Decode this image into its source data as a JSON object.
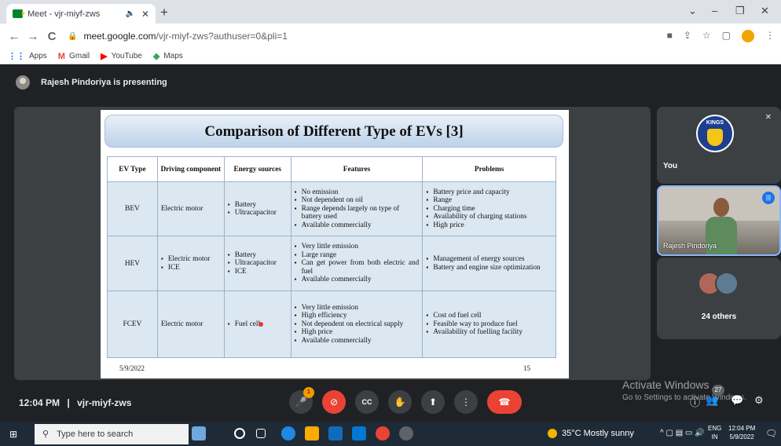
{
  "browser": {
    "tab_title": "Meet - vjr-miyf-zws",
    "tab_audio_icon": "speaker-icon",
    "tab_close": "✕",
    "new_tab": "+",
    "window_controls": [
      "⌄",
      "–",
      "❐",
      "✕"
    ],
    "nav": {
      "back": "←",
      "forward": "→",
      "reload": "C"
    },
    "url_host": "meet.google.com",
    "url_path": "/vjr-miyf-zws?authuser=0&pli=1",
    "bookmarks": [
      {
        "label": "Apps",
        "icon": "⋮⋮",
        "color": "#1a73e8"
      },
      {
        "label": "Gmail",
        "icon": "M",
        "color": "#ea4335"
      },
      {
        "label": "YouTube",
        "icon": "▶",
        "color": "#ff0000"
      },
      {
        "label": "Maps",
        "icon": "◆",
        "color": "#34a853"
      }
    ]
  },
  "meet": {
    "presenter_text": "Rajesh Pindoriya is presenting",
    "meeting_time": "12:04 PM",
    "meeting_separator": "|",
    "meeting_code": "vjr-miyf-zws",
    "raise_badge": "1",
    "people_badge": "27"
  },
  "slide": {
    "title": "Comparison of Different Type of EVs [3]",
    "headers": [
      "EV Type",
      "Driving component",
      "Energy sources",
      "Features",
      "Problems"
    ],
    "rows": [
      {
        "type": "BEV",
        "driving": "Electric motor",
        "energy": [
          "Battery",
          "Ultracapacitor"
        ],
        "features": [
          "No emission",
          "Not dependent on oil",
          "Range depends largely on type of battery used",
          "Available commercially"
        ],
        "problems": [
          "Battery price and capacity",
          "Range",
          "Charging time",
          "Availability of charging stations",
          "High price"
        ]
      },
      {
        "type": "HEV",
        "driving_list": [
          "Electric motor",
          "ICE"
        ],
        "energy": [
          "Battery",
          "Ultracapacitor",
          "ICE"
        ],
        "features": [
          "Very little emission",
          "Large range",
          "Can get power from both electric and fuel",
          "Available commercially"
        ],
        "problems": [
          "Management of energy sources",
          "Battery and engine size optimization"
        ]
      },
      {
        "type": "FCEV",
        "driving": "Electric motor",
        "energy": [
          "Fuel cell"
        ],
        "features": [
          "Very little emission",
          "High efficiency",
          "Not dependent on electrical supply",
          "High price",
          "Available commercially"
        ],
        "problems": [
          "Cost od fuel cell",
          "Feasible way to produce fuel",
          "Availability of fuelling facility"
        ]
      }
    ],
    "date": "5/9/2022",
    "page": "15"
  },
  "participants": {
    "you_label": "You",
    "logo_text": "KINGS",
    "cam_name": "Rajesh Pindoriya",
    "others_label": "24 others"
  },
  "watermark": {
    "line1": "Activate Windows",
    "line2": "Go to Settings to activate Windows."
  },
  "taskbar": {
    "search_placeholder": "Type here to search",
    "weather": "35°C  Mostly sunny",
    "lang1": "ENG",
    "lang2": "IN",
    "time": "12:04 PM",
    "date": "5/9/2022"
  }
}
